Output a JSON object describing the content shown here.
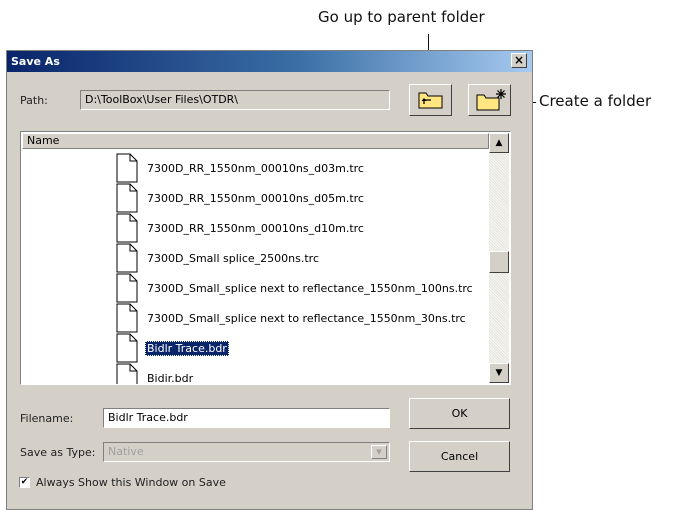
{
  "callouts": {
    "parent": "Go up to parent folder",
    "create": "Create a folder"
  },
  "dialog": {
    "title": "Save As",
    "close_glyph": "×",
    "path_label": "Path:",
    "path_value": "D:\\ToolBox\\User Files\\OTDR\\",
    "column_header": "Name",
    "files": [
      "7300D_RR_1550nm_00010ns_d03m.trc",
      "7300D_RR_1550nm_00010ns_d05m.trc",
      "7300D_RR_1550nm_00010ns_d10m.trc",
      "7300D_Small splice_2500ns.trc",
      "7300D_Small_splice next to reflectance_1550nm_100ns.trc",
      "7300D_Small_splice next to reflectance_1550nm_30ns.trc",
      "Bidlr Trace.bdr",
      "Bidir.bdr"
    ],
    "selected_file": "Bidlr Trace.bdr",
    "filename_label": "Filename:",
    "filename_value": "Bidlr Trace.bdr",
    "save_type_label": "Save as Type:",
    "save_type_value": "Native",
    "ok_label": "OK",
    "cancel_label": "Cancel",
    "always_show_label": "Always Show this Window on Save",
    "always_show_checked": true
  },
  "icons": {
    "close": "close-icon",
    "parent_folder": "folder-up-icon",
    "new_folder": "new-folder-icon",
    "file": "document-icon",
    "scroll_up": "chevron-up-icon",
    "scroll_down": "chevron-down-icon",
    "dropdown": "chevron-down-icon",
    "check": "checkmark-icon"
  },
  "colors": {
    "title_bar_start": "#0a246a",
    "title_bar_end": "#a6caf0",
    "selection": "#0a246a",
    "folder_yellow": "#ffe680",
    "dialog_bg": "#d4d0c8"
  }
}
